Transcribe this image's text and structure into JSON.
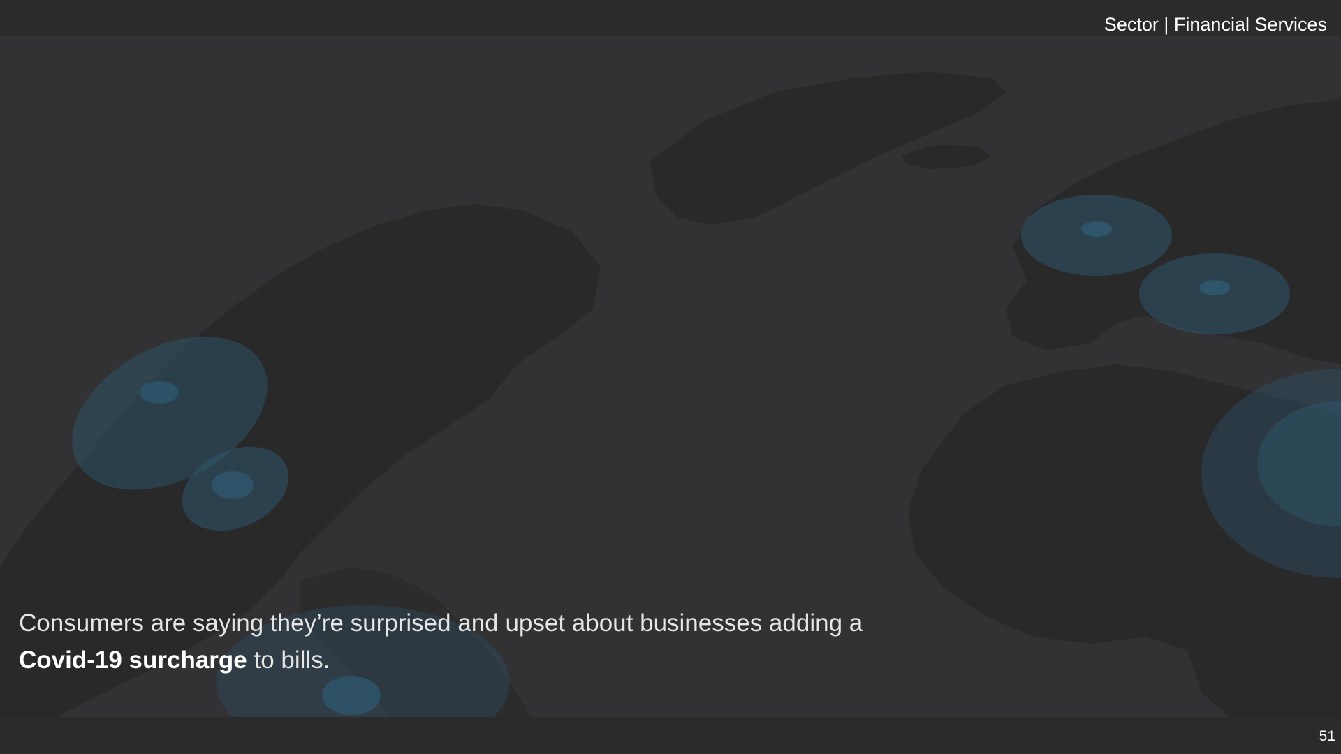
{
  "header": {
    "sector_label": "Sector | Financial Services"
  },
  "caption": {
    "line1": "Consumers are saying they’re surprised and upset about businesses adding a",
    "emphasis": "Covid-19 surcharge",
    "line2_rest": " to bills."
  },
  "footer": {
    "page_number": "51"
  },
  "colors": {
    "background": "#2b2b2c",
    "map_sea": "#323234",
    "landmass": "#272728",
    "hotspot": "#2f5a72",
    "text": "#ffffff"
  }
}
